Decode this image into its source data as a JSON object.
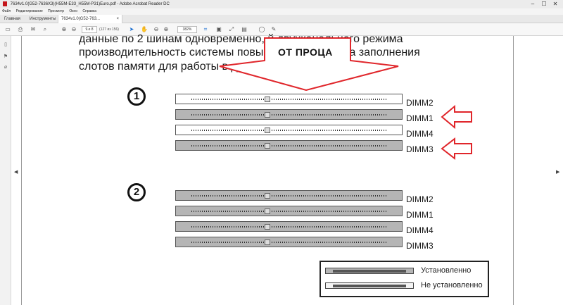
{
  "window": {
    "title": "7634v1.0(G52-7636X3)(H55M-E33_H55M-P31)Euro.pdf - Adobe Acrobat Reader DC",
    "controls": {
      "minimize": "–",
      "maximize": "☐",
      "close": "✕"
    }
  },
  "menu": {
    "items": [
      "Файл",
      "Редактирование",
      "Просмотр",
      "Окно",
      "Справка"
    ]
  },
  "tabs": {
    "home": "Главная",
    "tools": "Инструменты",
    "document": "7634v1.0(G52-763...",
    "document_close": "×"
  },
  "toolbar": {
    "page_current": "9.е 8",
    "page_total": "(127 из 156)",
    "zoom": "382%",
    "icons": [
      "save-icon",
      "print-icon",
      "mail-icon",
      "search-icon",
      "page-up-icon",
      "page-down-icon",
      "select-icon",
      "hand-icon",
      "zoom-out-icon",
      "zoom-in-icon",
      "crop-icon",
      "fit-icon",
      "expand-icon",
      "highlight-icon",
      "comment-icon",
      "draw-icon"
    ]
  },
  "document": {
    "text_line1": "данные по 2 шинам одновременно,                        й двухканального режима",
    "text_line2": "производительность системы повыш                  едены правила заполнения",
    "text_line3": "слотов памяти для работы в двухк",
    "callout": "ОТ ПРОЦА",
    "config1": {
      "number": "1",
      "slots": [
        {
          "label": "DIMM2",
          "state": "empty"
        },
        {
          "label": "DIMM1",
          "state": "installed"
        },
        {
          "label": "DIMM4",
          "state": "empty"
        },
        {
          "label": "DIMM3",
          "state": "installed"
        }
      ]
    },
    "config2": {
      "number": "2",
      "slots": [
        {
          "label": "DIMM2",
          "state": "installed"
        },
        {
          "label": "DIMM1",
          "state": "installed"
        },
        {
          "label": "DIMM4",
          "state": "installed"
        },
        {
          "label": "DIMM3",
          "state": "installed"
        }
      ]
    },
    "legend": {
      "installed": "Установленно",
      "not_installed": "Не установленно"
    }
  },
  "colors": {
    "arrow_red": "#e0262b",
    "slot_installed": "#b5b5b5",
    "slot_empty": "#f4f4f4"
  }
}
